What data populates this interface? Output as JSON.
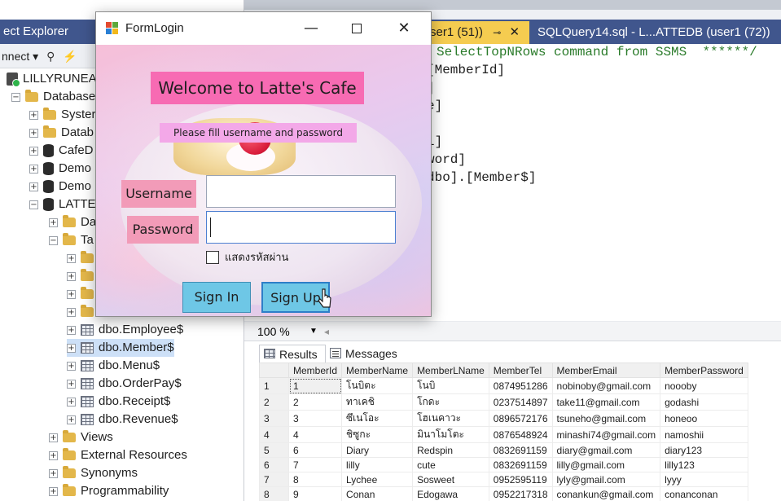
{
  "object_explorer": {
    "title": "ect Explorer",
    "toolbar_connect": "nnect ▾",
    "tree": [
      {
        "label": "LILLYRUNEA:",
        "icon": "server",
        "exp": ""
      },
      {
        "label": "Database",
        "icon": "folder",
        "exp": "−"
      },
      {
        "label": "Syster",
        "icon": "folder",
        "exp": "+"
      },
      {
        "label": "Datab",
        "icon": "folder",
        "exp": "+"
      },
      {
        "label": "CafeD",
        "icon": "db",
        "exp": "+"
      },
      {
        "label": "Demo",
        "icon": "db",
        "exp": "+"
      },
      {
        "label": "Demo",
        "icon": "db",
        "exp": "+"
      },
      {
        "label": "LATTE",
        "icon": "db",
        "exp": "−"
      },
      {
        "label": "Da",
        "icon": "folder",
        "exp": "+"
      },
      {
        "label": "Ta",
        "icon": "folder",
        "exp": "−"
      },
      {
        "label": "",
        "icon": "folder",
        "exp": "+"
      },
      {
        "label": "",
        "icon": "folder",
        "exp": "+"
      },
      {
        "label": "",
        "icon": "folder",
        "exp": "+"
      },
      {
        "label": "",
        "icon": "folder",
        "exp": "+"
      },
      {
        "label": "dbo.Employee$",
        "icon": "table",
        "exp": "+"
      },
      {
        "label": "dbo.Member$",
        "icon": "table",
        "exp": "+"
      },
      {
        "label": "dbo.Menu$",
        "icon": "table",
        "exp": "+"
      },
      {
        "label": "dbo.OrderPay$",
        "icon": "table",
        "exp": "+"
      },
      {
        "label": "dbo.Receipt$",
        "icon": "table",
        "exp": "+"
      },
      {
        "label": "dbo.Revenue$",
        "icon": "table",
        "exp": "+"
      },
      {
        "label": "Views",
        "icon": "folder",
        "exp": "+"
      },
      {
        "label": "External Resources",
        "icon": "folder",
        "exp": "+"
      },
      {
        "label": "Synonyms",
        "icon": "folder",
        "exp": "+"
      },
      {
        "label": "Programmability",
        "icon": "folder",
        "exp": "+"
      }
    ]
  },
  "editor": {
    "tab_active": "ser1 (51))",
    "tab_active_pin": "⊸",
    "tab_active_close": "✕",
    "tab_inactive": "SQLQuery14.sql - L...ATTEDB (user1 (72))",
    "lines": [
      {
        "text": "SelectTopNRows command from SSMS  ******/",
        "comment": true
      },
      {
        "text": "[MemberId]",
        "comment": false
      },
      {
        "text": "]",
        "comment": false
      },
      {
        "text": "e]",
        "comment": false
      },
      {
        "text": "",
        "comment": false
      },
      {
        "text": "l]",
        "comment": false
      },
      {
        "text": "word]",
        "comment": false
      },
      {
        "text": "dbo].[Member$]",
        "comment": false
      }
    ]
  },
  "results": {
    "zoom": "100 %",
    "tab_results": "Results",
    "tab_messages": "Messages",
    "columns": [
      "",
      "MemberId",
      "MemberName",
      "MemberLName",
      "MemberTel",
      "MemberEmail",
      "MemberPassword"
    ],
    "rows": [
      [
        "1",
        "1",
        "โนบิตะ",
        "โนบิ",
        "0874951286",
        "nobinoby@gmail.com",
        "noooby"
      ],
      [
        "2",
        "2",
        "ทาเคชิ",
        "โกดะ",
        "0237514897",
        "take11@gmail.com",
        "godashi"
      ],
      [
        "3",
        "3",
        "ซึเนโอะ",
        "โฮเนคาวะ",
        "0896572176",
        "tsuneho@gmail.com",
        "honeoo"
      ],
      [
        "4",
        "4",
        "ชิซูกะ",
        "มินาโมโตะ",
        "0876548924",
        "minashi74@gmail.com",
        "namoshii"
      ],
      [
        "5",
        "6",
        "Diary",
        "Redspin",
        "0832691159",
        "diary@gmail.com",
        "diary123"
      ],
      [
        "6",
        "7",
        "lilly",
        "cute",
        "0832691159",
        "lilly@gmail.com",
        "lilly123"
      ],
      [
        "7",
        "8",
        "Lychee",
        "Sosweet",
        "0952595119",
        "lyly@gmail.com",
        "lyyy"
      ],
      [
        "8",
        "9",
        "Conan",
        "Edogawa",
        "0952217318",
        "conankun@gmail.com",
        "conanconan"
      ]
    ]
  },
  "form_login": {
    "title": "FormLogin",
    "minimize": "—",
    "close": "✕",
    "welcome": "Welcome to Latte's Cafe",
    "subtitle": "Please fill username and password",
    "username_label": "Username",
    "password_label": "Password",
    "username_value": "",
    "password_value": "",
    "show_password_label": "แสดงรหัสผ่าน",
    "sign_in": "Sign In",
    "sign_up": "Sign Up"
  },
  "colors": {
    "ssms_blue": "#40568d",
    "active_tab": "#f5cc50",
    "welcome_bg": "#f76bb3",
    "subtitle_bg": "#f3a8e8",
    "label_bg": "#f29bb8",
    "button_bg": "#6ec7e6"
  }
}
